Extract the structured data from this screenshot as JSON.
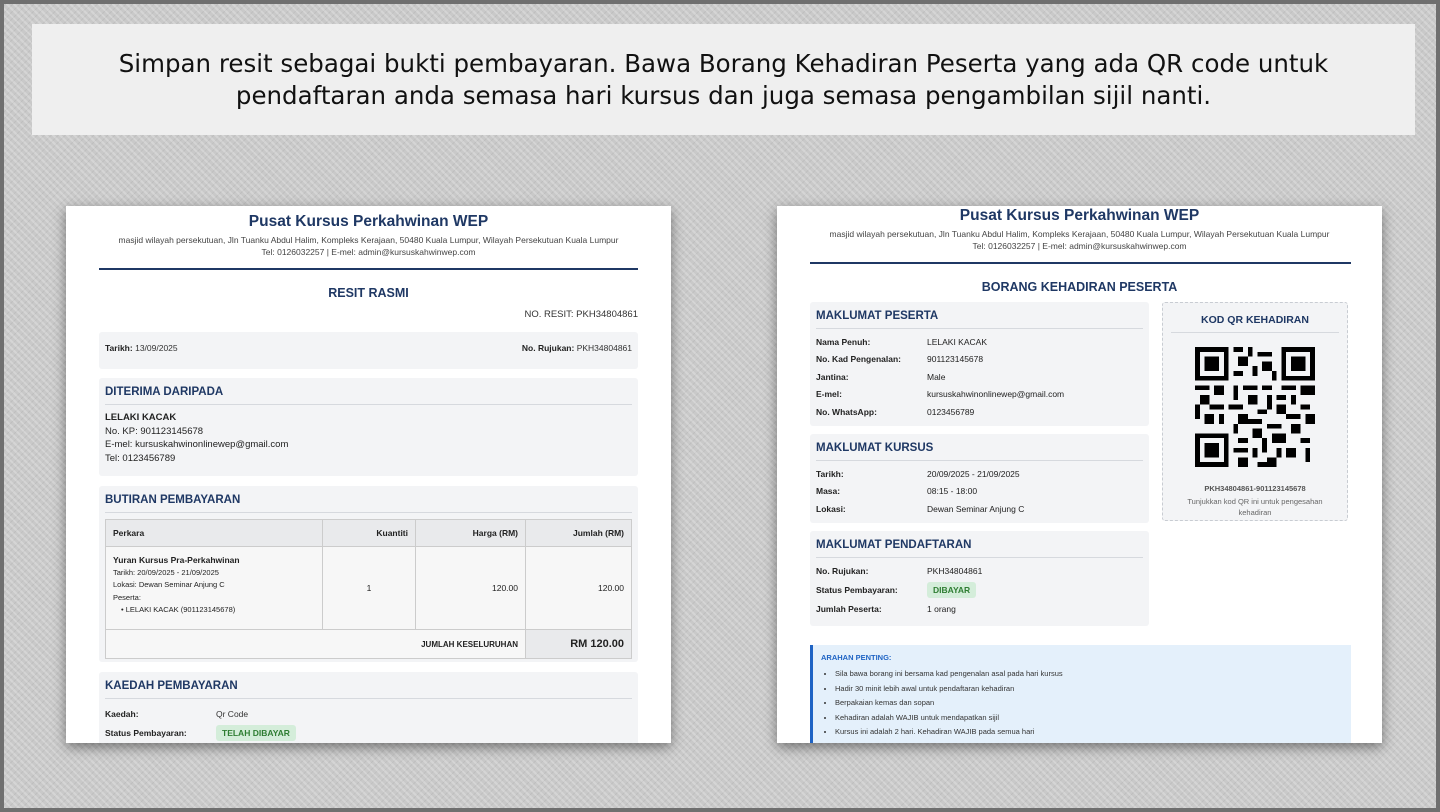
{
  "banner": {
    "text": "Simpan resit sebagai bukti pembayaran. Bawa Borang Kehadiran Peserta yang ada QR code untuk pendaftaran anda semasa hari kursus dan juga semasa pengambilan sijil nanti."
  },
  "org": {
    "name": "Pusat Kursus Perkahwinan WEP",
    "address": "masjid wilayah persekutuan, Jln Tuanku Abdul Halim, Kompleks Kerajaan, 50480 Kuala Lumpur, Wilayah Persekutuan Kuala Lumpur",
    "contact": "Tel: 0126032257 | E-mel: admin@kursuskahwinwep.com"
  },
  "receipt": {
    "title": "RESIT RASMI",
    "receipt_no": "NO. RESIT: PKH34804861",
    "date_label": "Tarikh:",
    "date": "13/09/2025",
    "ref_label": "No. Rujukan:",
    "ref": "PKH34804861",
    "received_from": {
      "title": "DITERIMA DARIPADA",
      "name": "LELAKI KACAK",
      "kp": "No. KP: 901123145678",
      "email": "E-mel: kursuskahwinonlinewep@gmail.com",
      "tel": "Tel: 0123456789"
    },
    "payment_details": {
      "title": "BUTIRAN PEMBAYARAN",
      "headers": [
        "Perkara",
        "Kuantiti",
        "Harga (RM)",
        "Jumlah (RM)"
      ],
      "item": {
        "name": "Yuran Kursus Pra-Perkahwinan",
        "date": "Tarikh: 20/09/2025 - 21/09/2025",
        "location": "Lokasi: Dewan Seminar Anjung C",
        "participants_label": "Peserta:",
        "participant": "LELAKI KACAK (901123145678)",
        "qty": "1",
        "price": "120.00",
        "total": "120.00"
      },
      "grand_total_label": "JUMLAH KESELURUHAN",
      "grand_total": "RM 120.00"
    },
    "payment_method": {
      "title": "KAEDAH PEMBAYARAN",
      "method_label": "Kaedah:",
      "method": "Qr Code",
      "status_label": "Status Pembayaran:",
      "status": "TELAH DIBAYAR"
    }
  },
  "attendance": {
    "title": "BORANG KEHADIRAN PESERTA",
    "participant": {
      "title": "MAKLUMAT PESERTA",
      "rows": [
        {
          "k": "Nama Penuh:",
          "v": "LELAKI KACAK"
        },
        {
          "k": "No. Kad Pengenalan:",
          "v": "901123145678"
        },
        {
          "k": "Jantina:",
          "v": "Male"
        },
        {
          "k": "E-mel:",
          "v": "kursuskahwinonlinewep@gmail.com"
        },
        {
          "k": "No. WhatsApp:",
          "v": "0123456789"
        }
      ]
    },
    "course": {
      "title": "MAKLUMAT KURSUS",
      "rows": [
        {
          "k": "Tarikh:",
          "v": "20/09/2025 - 21/09/2025"
        },
        {
          "k": "Masa:",
          "v": "08:15 - 18:00"
        },
        {
          "k": "Lokasi:",
          "v": "Dewan Seminar Anjung C"
        }
      ]
    },
    "registration": {
      "title": "MAKLUMAT PENDAFTARAN",
      "ref_label": "No. Rujukan:",
      "ref": "PKH34804861",
      "status_label": "Status Pembayaran:",
      "status": "DIBAYAR",
      "count_label": "Jumlah Peserta:",
      "count": "1 orang"
    },
    "qr": {
      "title": "KOD QR KEHADIRAN",
      "code": "PKH34804861-901123145678",
      "caption": "Tunjukkan kod QR ini untuk pengesahan kehadiran"
    },
    "notice": {
      "title": "ARAHAN PENTING:",
      "items": [
        "Sila bawa borang ini bersama kad pengenalan asal pada hari kursus",
        "Hadir 30 minit lebih awal untuk pendaftaran kehadiran",
        "Berpakaian kemas dan sopan",
        "Kehadiran adalah WAJIB untuk mendapatkan sijil",
        "Kursus ini adalah 2 hari. Kehadiran WAJIB pada semua hari"
      ]
    }
  },
  "colors": {
    "brand": "#1f3864",
    "paid_bg": "#d4edda",
    "paid_text": "#2e7d32",
    "notice_accent": "#1e63c4"
  }
}
